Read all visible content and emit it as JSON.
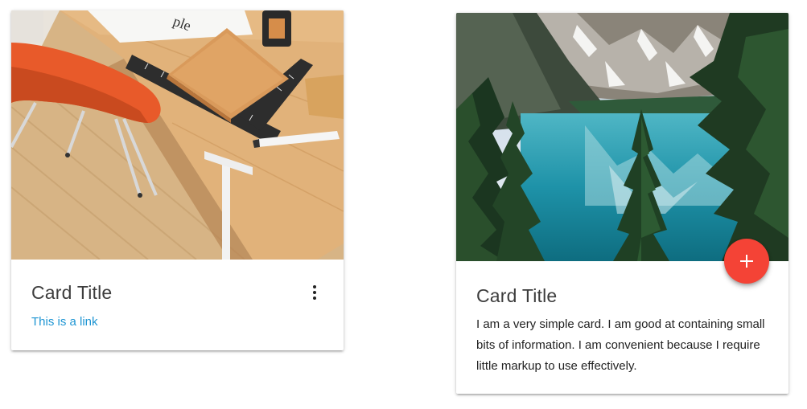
{
  "card_left": {
    "image_alt": "Desk workspace with orange chair",
    "title": "Card Title",
    "link_label": "This is a link",
    "menu_icon": "more-vert-icon"
  },
  "card_right": {
    "image_alt": "Mountain lake with pine trees",
    "title": "Card Title",
    "text": "I am a very simple card. I am good at containing small bits of information. I am convenient because I require little markup to use effectively.",
    "fab_icon": "plus-icon"
  },
  "colors": {
    "link": "#1e95d3",
    "fab": "#f44336",
    "title": "#3d3d3d"
  }
}
